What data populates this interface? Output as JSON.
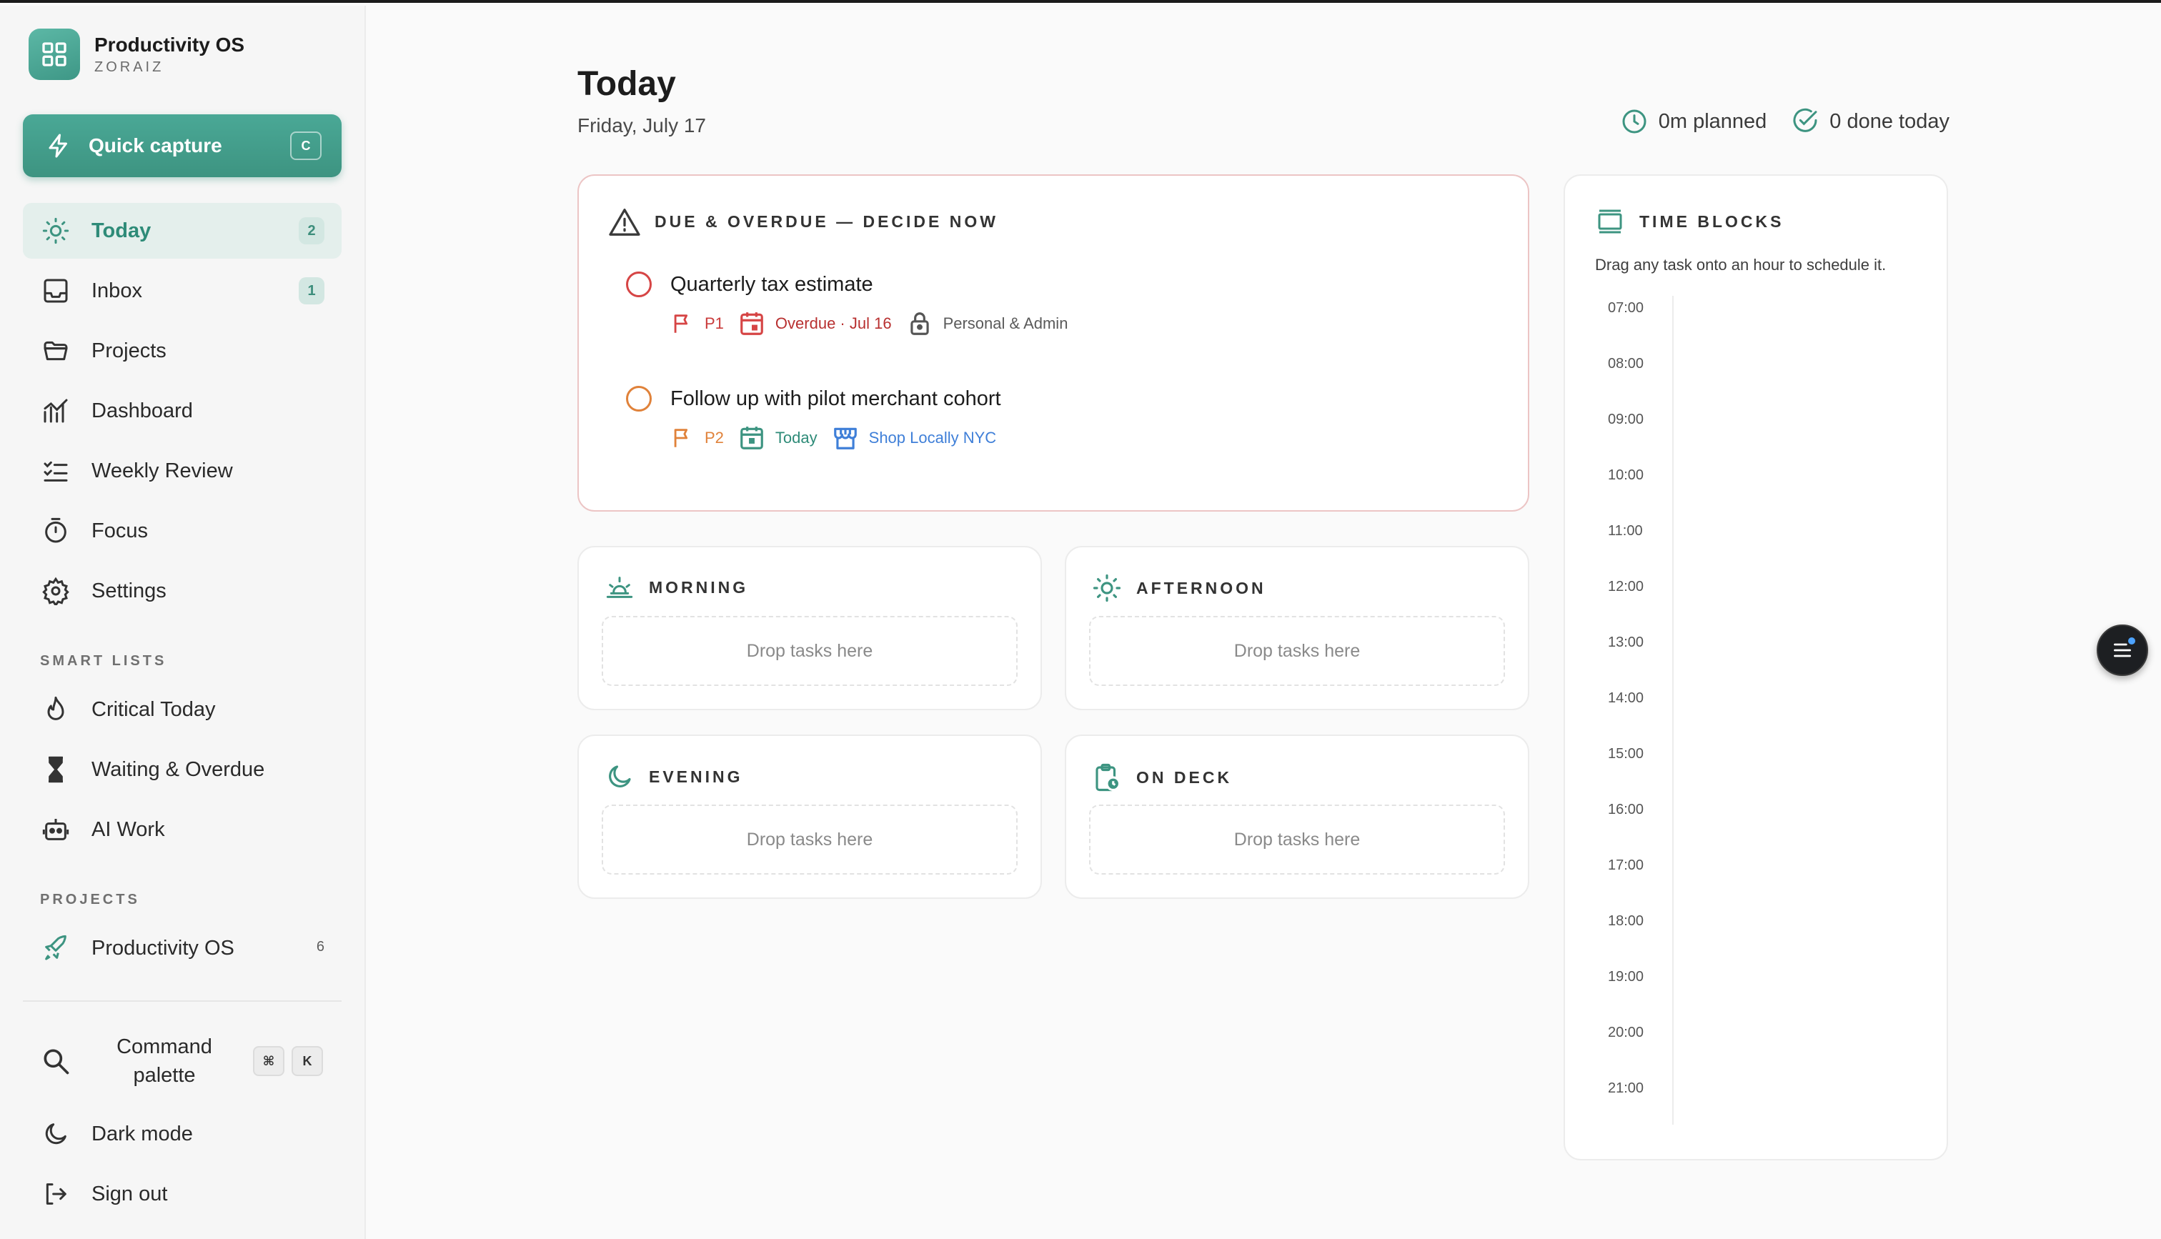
{
  "brand": {
    "name": "Productivity OS",
    "workspace": "ZORAIZ"
  },
  "quick_capture": {
    "label": "Quick capture",
    "shortcut": "C"
  },
  "nav": [
    {
      "label": "Today",
      "badge": "2",
      "icon": "sun-icon",
      "active": true
    },
    {
      "label": "Inbox",
      "badge": "1",
      "icon": "inbox-icon"
    },
    {
      "label": "Projects",
      "icon": "folder-icon"
    },
    {
      "label": "Dashboard",
      "icon": "chart-icon"
    },
    {
      "label": "Weekly Review",
      "icon": "checklist-icon"
    },
    {
      "label": "Focus",
      "icon": "timer-icon"
    },
    {
      "label": "Settings",
      "icon": "gear-icon"
    }
  ],
  "smart_lists": {
    "heading": "SMART LISTS",
    "items": [
      {
        "label": "Critical Today",
        "icon": "flame-icon"
      },
      {
        "label": "Waiting & Overdue",
        "icon": "hourglass-icon"
      },
      {
        "label": "AI Work",
        "icon": "robot-icon"
      }
    ]
  },
  "projects": {
    "heading": "PROJECTS",
    "items": [
      {
        "label": "Productivity OS",
        "count": "6",
        "icon": "rocket-icon"
      }
    ]
  },
  "footer": {
    "command_palette": {
      "label": "Command palette",
      "keys": [
        "⌘",
        "K"
      ]
    },
    "dark_mode": "Dark mode",
    "sign_out": "Sign out"
  },
  "header": {
    "title": "Today",
    "date": "Friday, July 17",
    "planned": "0m planned",
    "done": "0 done today"
  },
  "overdue": {
    "heading": "DUE & OVERDUE — DECIDE NOW",
    "tasks": [
      {
        "title": "Quarterly tax estimate",
        "priority": "P1",
        "due": "Overdue · Jul 16",
        "project": "Personal & Admin",
        "color": "#d64545"
      },
      {
        "title": "Follow up with pilot merchant cohort",
        "priority": "P2",
        "due": "Today",
        "project": "Shop Locally NYC",
        "color": "#e0823a"
      }
    ]
  },
  "buckets": {
    "morning": {
      "label": "MORNING",
      "drop": "Drop tasks here"
    },
    "afternoon": {
      "label": "AFTERNOON",
      "drop": "Drop tasks here"
    },
    "evening": {
      "label": "EVENING",
      "drop": "Drop tasks here"
    },
    "on_deck": {
      "label": "ON DECK",
      "drop": "Drop tasks here"
    }
  },
  "time_blocks": {
    "heading": "TIME BLOCKS",
    "subtitle": "Drag any task onto an hour to schedule it.",
    "hours": [
      "07:00",
      "08:00",
      "09:00",
      "10:00",
      "11:00",
      "12:00",
      "13:00",
      "14:00",
      "15:00",
      "16:00",
      "17:00",
      "18:00",
      "19:00",
      "20:00",
      "21:00"
    ]
  },
  "colors": {
    "accent": "#3d9481",
    "danger": "#d64545",
    "warning": "#e0823a",
    "info": "#3f7fd8"
  }
}
